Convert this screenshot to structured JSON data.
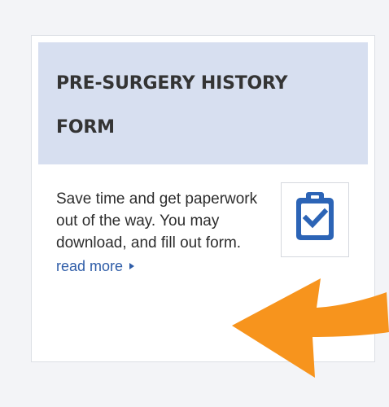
{
  "card": {
    "title": "PRE-SURGERY HISTORY FORM",
    "description": "Save time and get paperwork out of the way. You may download, and fill out form.",
    "read_more": "read more",
    "icon": "clipboard-check-icon"
  },
  "overlay": {
    "arrow_icon": "orange-arrow-icon",
    "arrow_color": "#f7941d"
  },
  "colors": {
    "background": "#f3f4f7",
    "header_background": "#d7dff0",
    "title": "#343434",
    "body_text": "#2d2d2d",
    "link": "#2f5da8",
    "icon_blue": "#2c64b6"
  }
}
